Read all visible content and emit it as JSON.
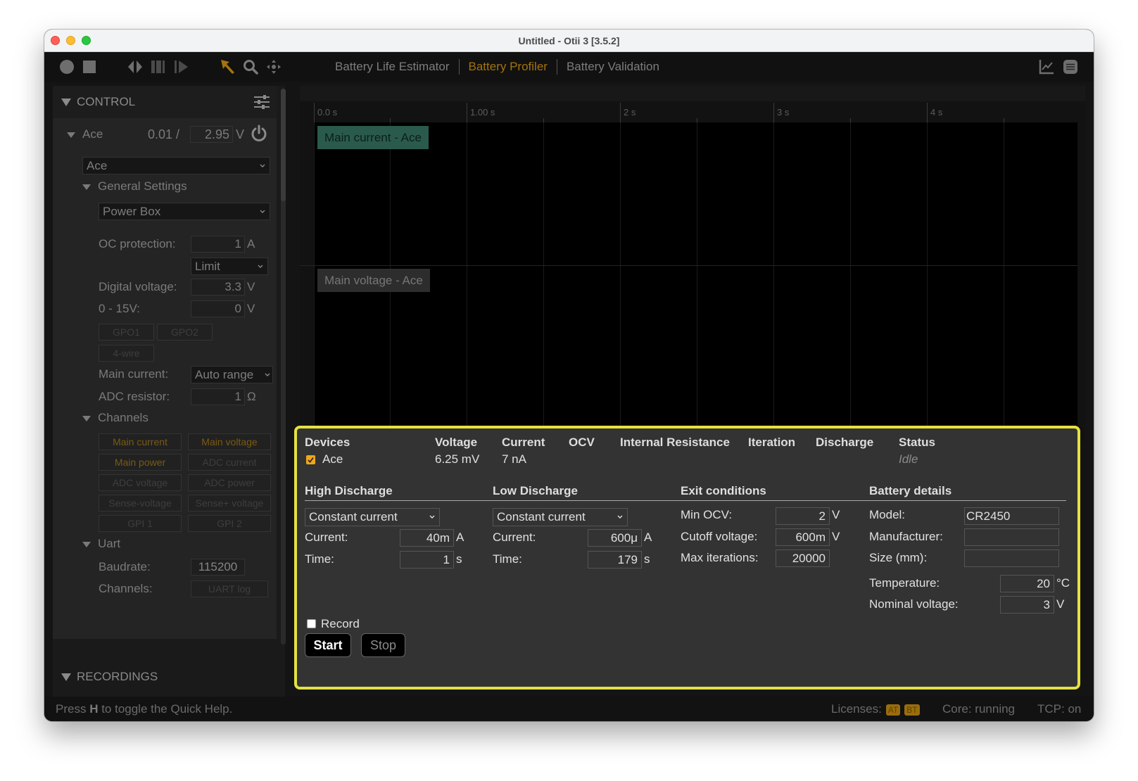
{
  "window": {
    "title": "Untitled - Otii 3 [3.5.2]"
  },
  "toolbar": {
    "icons": [
      "record-icon",
      "stop-icon",
      "split-icon",
      "bars-icon",
      "play-next-icon",
      "pointer-icon",
      "zoom-icon",
      "pan-icon",
      "chart-icon",
      "menu-icon"
    ],
    "tabs": [
      {
        "label": "Battery Life Estimator",
        "active": false
      },
      {
        "label": "Battery Profiler",
        "active": true
      },
      {
        "label": "Battery Validation",
        "active": false
      }
    ]
  },
  "sidebar": {
    "control_title": "CONTROL",
    "recordings_title": "RECORDINGS",
    "device": {
      "name": "Ace",
      "voltage_reading": "0.01 /",
      "voltage_set": "2.95",
      "voltage_unit": "V"
    },
    "device_select": "Ace",
    "general_settings": {
      "title": "General Settings",
      "mode_select": "Power Box",
      "oc_protection_label": "OC protection:",
      "oc_protection_value": "1",
      "oc_protection_unit": "A",
      "oc_mode_select": "Limit",
      "digital_voltage_label": "Digital voltage:",
      "digital_voltage_value": "3.3",
      "digital_voltage_unit": "V",
      "range_label": "0 - 15V:",
      "range_value": "0",
      "range_unit": "V",
      "gpo_buttons": [
        "GPO1",
        "GPO2",
        "4-wire"
      ],
      "main_current_label": "Main current:",
      "main_current_select": "Auto range",
      "adc_resistor_label": "ADC resistor:",
      "adc_resistor_value": "1",
      "adc_resistor_unit": "Ω"
    },
    "channels": {
      "title": "Channels",
      "items": [
        {
          "label": "Main current",
          "enabled": true
        },
        {
          "label": "Main voltage",
          "enabled": true
        },
        {
          "label": "Main power",
          "enabled": true
        },
        {
          "label": "ADC current",
          "enabled": false
        },
        {
          "label": "ADC voltage",
          "enabled": false
        },
        {
          "label": "ADC power",
          "enabled": false
        },
        {
          "label": "Sense-voltage",
          "enabled": false
        },
        {
          "label": "Sense+ voltage",
          "enabled": false
        },
        {
          "label": "GPI 1",
          "enabled": false
        },
        {
          "label": "GPI 2",
          "enabled": false
        }
      ]
    },
    "uart": {
      "title": "Uart",
      "baudrate_label": "Baudrate:",
      "baudrate_value": "115200",
      "channels_label": "Channels:",
      "channels_button": "UART log"
    }
  },
  "plot": {
    "ticks": [
      "0.0 s",
      "1.00 s",
      "2 s",
      "3 s",
      "4 s"
    ],
    "traces": [
      {
        "label": "Main current - Ace",
        "color": "#2a5a4c",
        "text_color": "#0c1f19"
      },
      {
        "label": "Main voltage - Ace",
        "color": "#2d2d2d",
        "text_color": "#767676"
      }
    ]
  },
  "profiler": {
    "headers": {
      "devices": "Devices",
      "voltage": "Voltage",
      "current": "Current",
      "ocv": "OCV",
      "internal_resistance": "Internal Resistance",
      "iteration": "Iteration",
      "discharge": "Discharge",
      "status": "Status"
    },
    "device_row": {
      "name": "Ace",
      "checked": true,
      "voltage": "6.25 mV",
      "current": "7 nA",
      "ocv": "",
      "internal_resistance": "",
      "iteration": "",
      "discharge": "",
      "status": "Idle"
    },
    "high_discharge": {
      "title": "High Discharge",
      "mode": "Constant current",
      "current_label": "Current:",
      "current_value": "40m",
      "current_unit": "A",
      "time_label": "Time:",
      "time_value": "1",
      "time_unit": "s"
    },
    "low_discharge": {
      "title": "Low Discharge",
      "mode": "Constant current",
      "current_label": "Current:",
      "current_value": "600μ",
      "current_unit": "A",
      "time_label": "Time:",
      "time_value": "179",
      "time_unit": "s"
    },
    "exit_conditions": {
      "title": "Exit conditions",
      "min_ocv_label": "Min OCV:",
      "min_ocv_value": "2",
      "min_ocv_unit": "V",
      "cutoff_label": "Cutoff voltage:",
      "cutoff_value": "600m",
      "cutoff_unit": "V",
      "max_iter_label": "Max iterations:",
      "max_iter_value": "20000"
    },
    "battery_details": {
      "title": "Battery details",
      "model_label": "Model:",
      "model_value": "CR2450",
      "manufacturer_label": "Manufacturer:",
      "manufacturer_value": "",
      "size_label": "Size (mm):",
      "size_value": "",
      "temperature_label": "Temperature:",
      "temperature_value": "20",
      "temperature_unit": "°C",
      "nominal_label": "Nominal voltage:",
      "nominal_value": "3",
      "nominal_unit": "V"
    },
    "record_label": "Record",
    "record_checked": false,
    "start_label": "Start",
    "stop_label": "Stop"
  },
  "statusbar": {
    "help_prefix": "Press ",
    "help_key": "H",
    "help_suffix": " to toggle the Quick Help.",
    "licenses_label": "Licenses:",
    "licenses": [
      "AT",
      "BT"
    ],
    "core": "Core: running",
    "tcp": "TCP: on"
  },
  "colors": {
    "accent": "#a4730e",
    "highlight_border": "#e5e142",
    "checkbox": "#f0a51a"
  }
}
